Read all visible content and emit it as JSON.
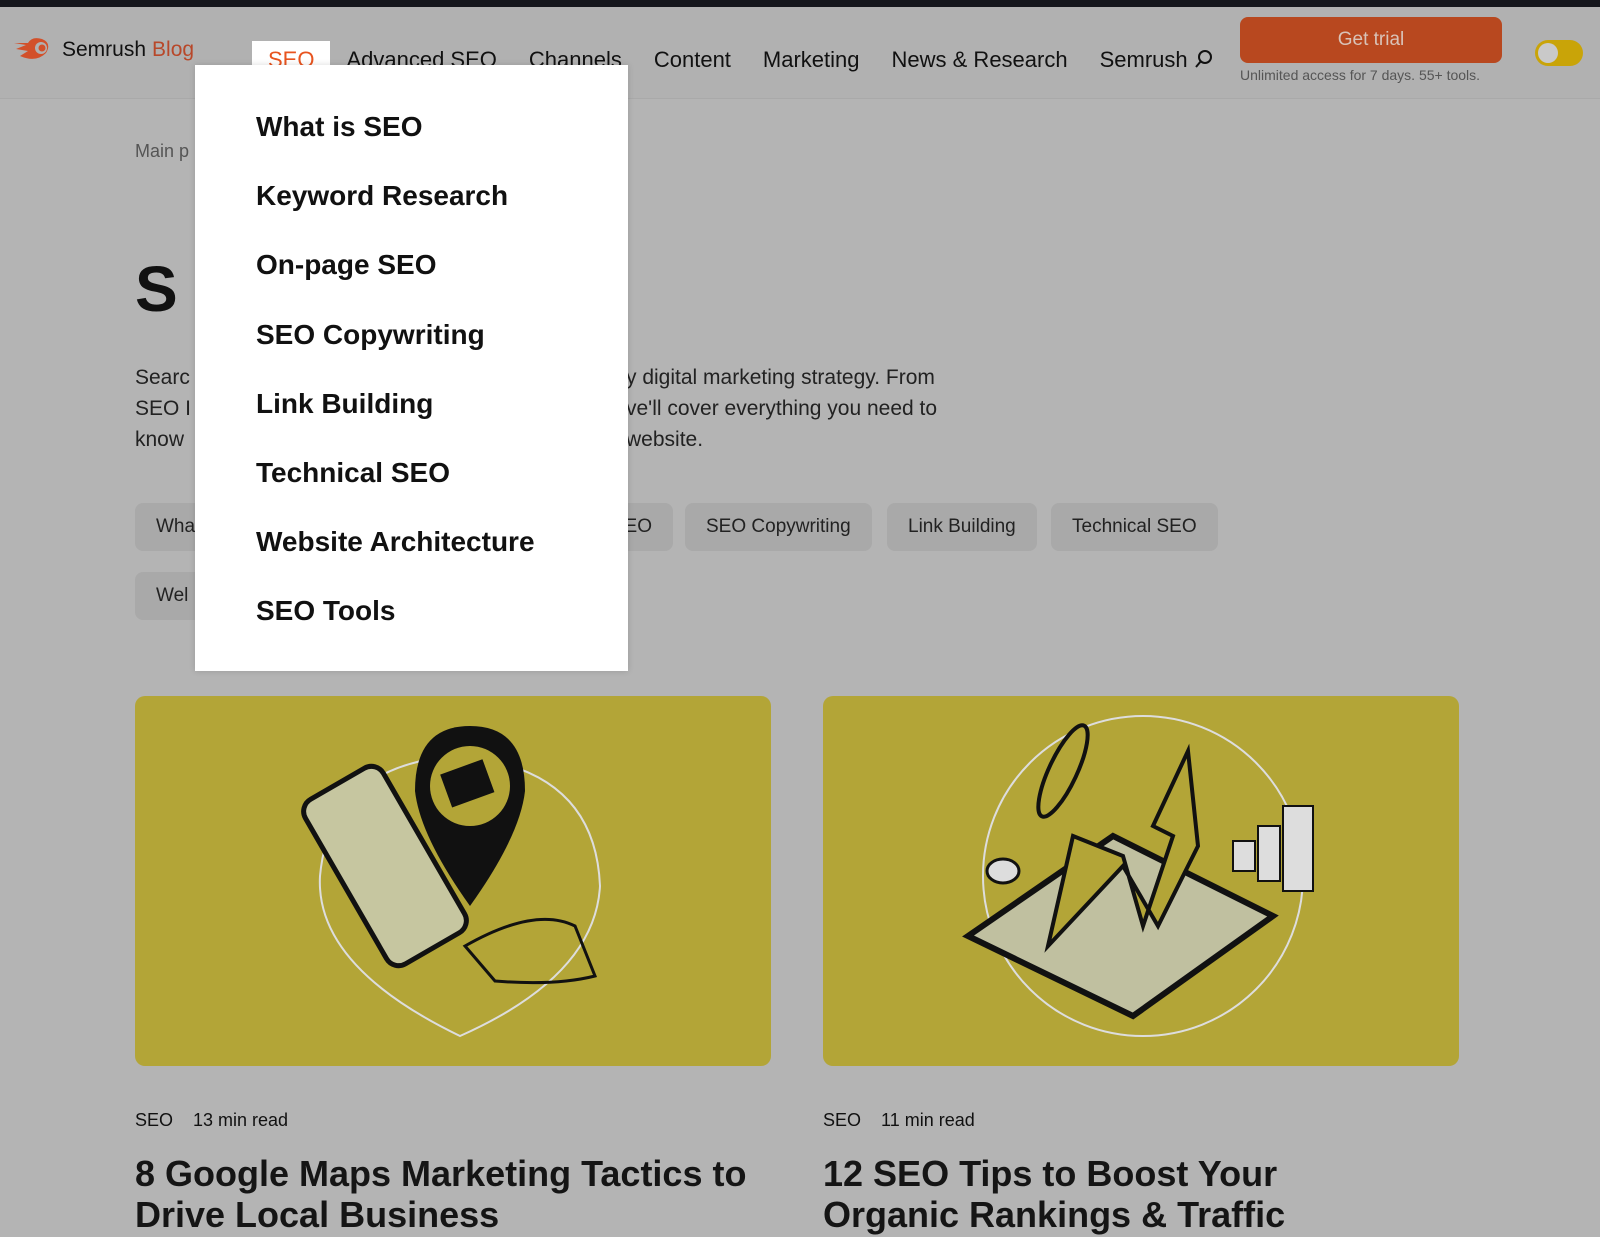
{
  "header": {
    "logo": {
      "brand": "Semrush",
      "suffix": "Blog"
    },
    "nav": [
      "SEO",
      "Advanced SEO",
      "Channels",
      "Content",
      "Marketing",
      "News & Research",
      "Semrush"
    ],
    "active_nav": "SEO",
    "cta": {
      "label": "Get trial",
      "sub": "Unlimited access for 7 days. 55+ tools."
    },
    "theme_toggle": {
      "on": false
    }
  },
  "page": {
    "breadcrumb_fragment": "Main p",
    "title_fragment": "S",
    "intro_left": [
      "Searc",
      "SEO I",
      "know"
    ],
    "intro_right": [
      "y digital marketing strategy. From",
      "ve'll cover everything you need to",
      "website."
    ],
    "tags": [
      "Wha",
      "EO",
      "SEO Copywriting",
      "Link Building",
      "Technical SEO",
      "Wel"
    ]
  },
  "dropdown": [
    "What is SEO",
    "Keyword Research",
    "On-page SEO",
    "SEO Copywriting",
    "Link Building",
    "Technical SEO",
    "Website Architecture",
    "SEO Tools"
  ],
  "articles": [
    {
      "category": "SEO",
      "read": "13 min read",
      "title": "8 Google Maps Marketing Tactics to Drive Local Business"
    },
    {
      "category": "SEO",
      "read": "11 min read",
      "title": "12 SEO Tips to Boost Your Organic Rankings & Traffic"
    }
  ],
  "colors": {
    "accent": "#e8541f",
    "cta": "#b8481f",
    "card": "#b3a537",
    "toggle": "#c9a408"
  }
}
